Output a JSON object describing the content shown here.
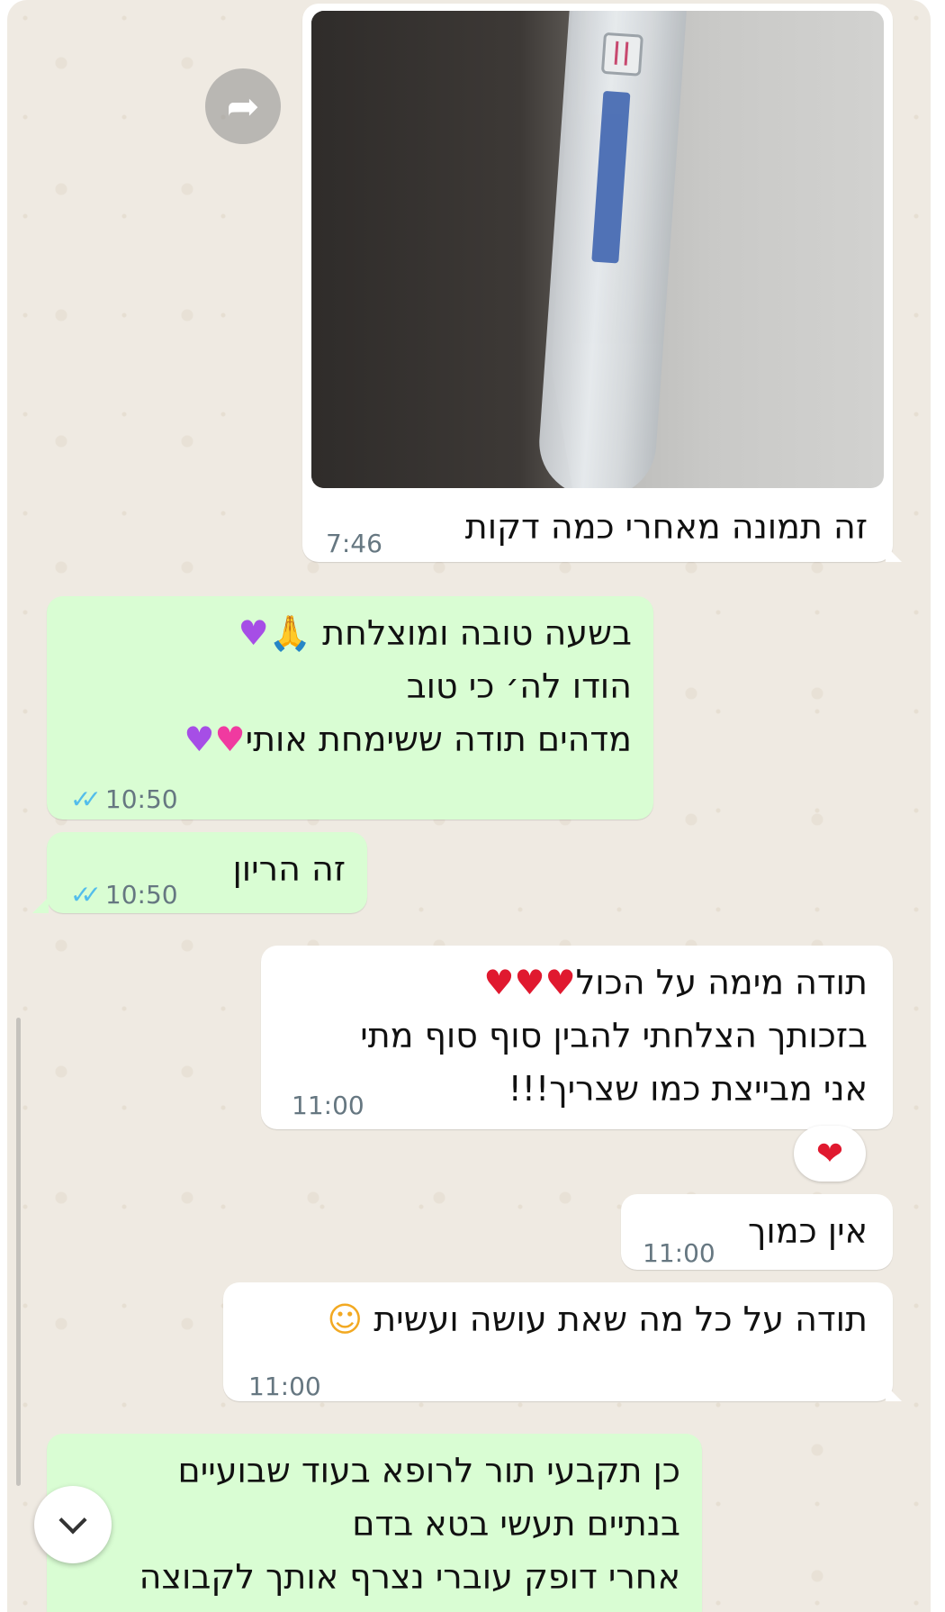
{
  "messages": [
    {
      "id": "m1",
      "direction": "incoming",
      "has_image": true,
      "lines": [
        "זה תמונה מאחרי כמה דקות"
      ],
      "time": "7:46"
    },
    {
      "id": "m2",
      "direction": "outgoing",
      "lines": [
        "בשעה טובה ומוצלחת",
        "הודו לה׳ כי טוב",
        "מדהים תודה ששימחת אותי"
      ],
      "time": "10:50",
      "read": true
    },
    {
      "id": "m3",
      "direction": "outgoing",
      "lines": [
        "זה הריון"
      ],
      "time": "10:50",
      "read": true
    },
    {
      "id": "m4",
      "direction": "incoming",
      "lines": [
        "תודה מימה על הכול",
        "בזכותך הצלחתי להבין סוף סוף מתי",
        "אני מבייצת כמו שצריך!!!"
      ],
      "time": "11:00",
      "reaction": "❤"
    },
    {
      "id": "m5",
      "direction": "incoming",
      "lines": [
        "אין כמוך"
      ],
      "time": "11:00"
    },
    {
      "id": "m6",
      "direction": "incoming",
      "lines": [
        "תודה על כל מה שאת עושה ועשית"
      ],
      "time": "11:00"
    },
    {
      "id": "m7",
      "direction": "outgoing",
      "lines": [
        "כן תקבעי תור לרופא בעוד שבועיים",
        "בנתיים תעשי בטא בדם",
        "אחרי דופק עוברי נצרף אותך לקבוצה"
      ]
    }
  ],
  "icons": {
    "forward": "forward-arrow-icon",
    "scroll_down": "chevron-down-icon",
    "ticks": "double-check-icon"
  },
  "emoji": {
    "pray": "🙏",
    "heart_purple": "♥",
    "heart_pink": "♥",
    "heart_red": "♥",
    "smile_hearts": "☺"
  },
  "colors": {
    "incoming_bubble": "#ffffff",
    "outgoing_bubble": "#d9fdd3",
    "wallpaper": "#efeae2",
    "read_ticks": "#53bdeb",
    "meta_text": "#667781"
  }
}
